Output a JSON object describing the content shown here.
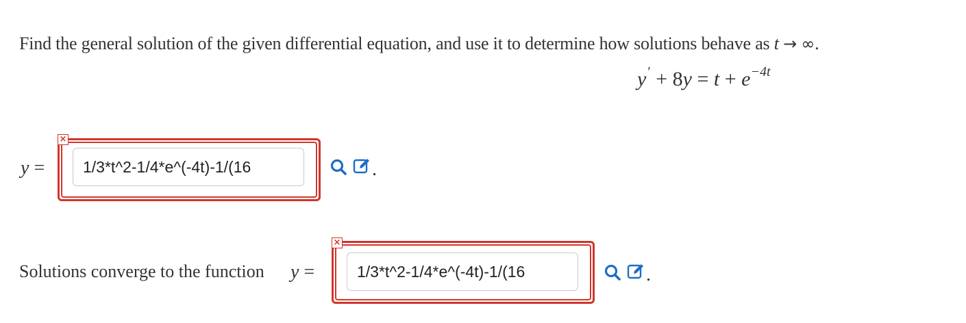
{
  "problem": {
    "text": "Find the general solution of the given differential equation, and use it to determine how solutions behave as",
    "variable": "t",
    "arrow": "→",
    "infinity": "∞",
    "end": "."
  },
  "equation": {
    "y": "y",
    "prime": "′",
    "plus1": "+ 8",
    "y2": "y",
    "eq": "=",
    "t": "t",
    "plus2": "+",
    "e": "e",
    "exponent": "−4t"
  },
  "answer1": {
    "lhs_var": "y",
    "lhs_eq": "=",
    "value": "1/3*t^2-1/4*e^(-4t)-1/(16",
    "status_mark": "×",
    "trailing": "."
  },
  "answer2": {
    "prompt": "Solutions converge to the function",
    "lhs_var": "y",
    "lhs_eq": "=",
    "value": "1/3*t^2-1/4*e^(-4t)-1/(16",
    "status_mark": "×",
    "trailing": "."
  },
  "icons": {
    "preview": "magnifier-icon",
    "edit": "pencil-edit-icon"
  },
  "colors": {
    "error": "#d0352b",
    "icon_blue": "#1a6ec5",
    "text": "#333333"
  }
}
